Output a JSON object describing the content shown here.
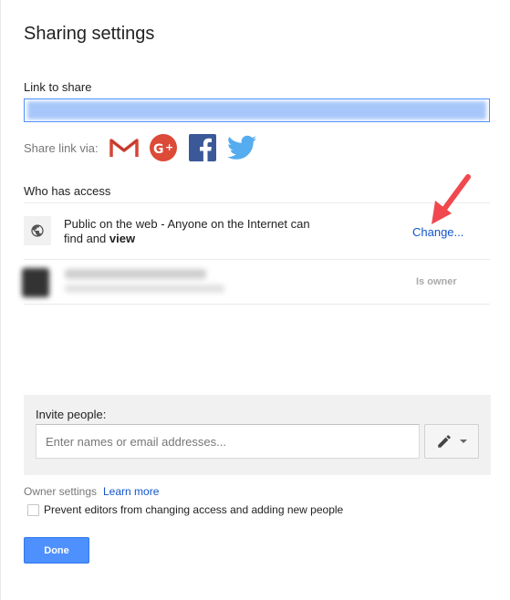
{
  "dialog": {
    "title": "Sharing settings"
  },
  "link": {
    "label": "Link to share",
    "value": "",
    "value_state": "selected (blurred)"
  },
  "share_via": {
    "label": "Share link via:",
    "icons": [
      "gmail-icon",
      "google-plus-icon",
      "facebook-icon",
      "twitter-icon"
    ]
  },
  "access": {
    "label": "Who has access",
    "public": {
      "text": "Public on the web - Anyone on the Internet can find and",
      "permission": "view",
      "change_label": "Change..."
    },
    "owner": {
      "role": "Is owner"
    }
  },
  "invite": {
    "label": "Invite people:",
    "placeholder": "Enter names or email addresses..."
  },
  "owner_settings": {
    "label": "Owner settings",
    "learn_more": "Learn more",
    "prevent_label": "Prevent editors from changing access and adding new people",
    "prevent_checked": false
  },
  "done_label": "Done",
  "colors": {
    "accent": "#4d90fe",
    "link": "#1155cc",
    "annotation_arrow": "#f0484e"
  }
}
